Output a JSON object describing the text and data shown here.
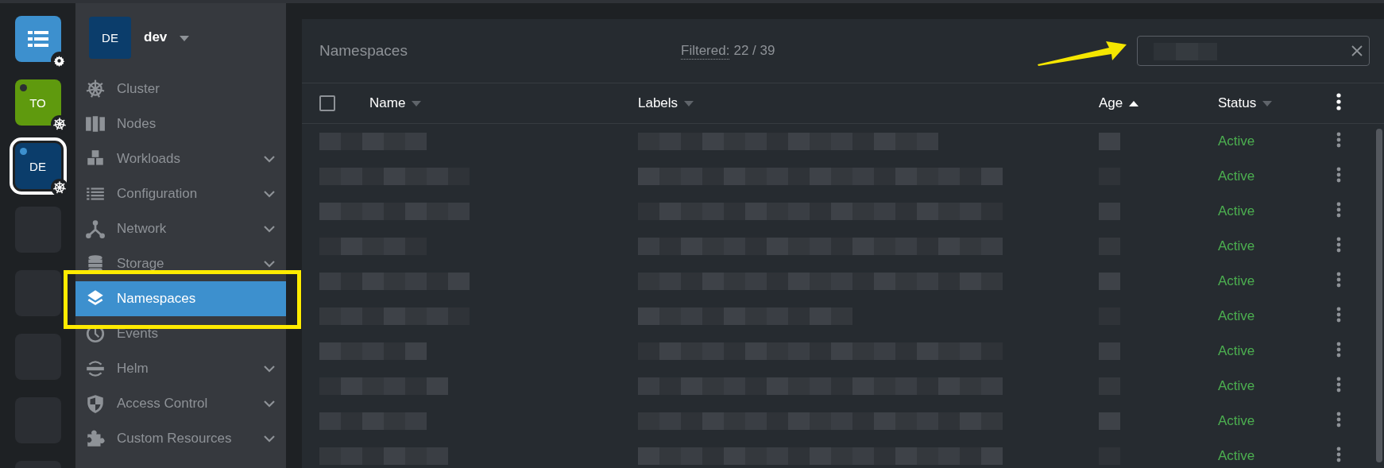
{
  "rail": [
    {
      "kind": "app",
      "selected": false
    },
    {
      "kind": "cluster",
      "initials": "TO",
      "color": "#5f9a0e",
      "online": false,
      "selected": false
    },
    {
      "kind": "cluster",
      "initials": "DE",
      "color": "#0b3d6b",
      "online": true,
      "selected": true
    },
    {
      "kind": "empty",
      "selected": false
    },
    {
      "kind": "empty",
      "selected": false
    },
    {
      "kind": "empty",
      "selected": false
    },
    {
      "kind": "empty",
      "selected": false
    },
    {
      "kind": "empty",
      "selected": false
    }
  ],
  "sidebar": {
    "cluster": {
      "initials": "DE",
      "name": "dev"
    },
    "items": [
      {
        "label": "Cluster",
        "expandable": false,
        "selected": false
      },
      {
        "label": "Nodes",
        "expandable": false,
        "selected": false
      },
      {
        "label": "Workloads",
        "expandable": true,
        "selected": false
      },
      {
        "label": "Configuration",
        "expandable": true,
        "selected": false
      },
      {
        "label": "Network",
        "expandable": true,
        "selected": false
      },
      {
        "label": "Storage",
        "expandable": true,
        "selected": false
      },
      {
        "label": "Namespaces",
        "expandable": false,
        "selected": true
      },
      {
        "label": "Events",
        "expandable": false,
        "selected": false
      },
      {
        "label": "Helm",
        "expandable": true,
        "selected": false
      },
      {
        "label": "Access Control",
        "expandable": true,
        "selected": false
      },
      {
        "label": "Custom Resources",
        "expandable": true,
        "selected": false
      }
    ]
  },
  "panel": {
    "title": "Namespaces",
    "filter_label": "Filtered:",
    "filter_count": "22 / 39"
  },
  "table": {
    "columns": [
      {
        "label": "Name",
        "sorted": false
      },
      {
        "label": "Labels",
        "sorted": false
      },
      {
        "label": "Age",
        "sorted": true
      },
      {
        "label": "Status",
        "sorted": false
      }
    ],
    "select_all": {
      "checked": false
    },
    "rows": [
      {
        "status": "Active"
      },
      {
        "status": "Active"
      },
      {
        "status": "Active"
      },
      {
        "status": "Active"
      },
      {
        "status": "Active"
      },
      {
        "status": "Active"
      },
      {
        "status": "Active"
      },
      {
        "status": "Active"
      },
      {
        "status": "Active"
      },
      {
        "status": "Active"
      }
    ]
  },
  "annotations": {
    "highlight_frame": true,
    "arrow": true
  }
}
